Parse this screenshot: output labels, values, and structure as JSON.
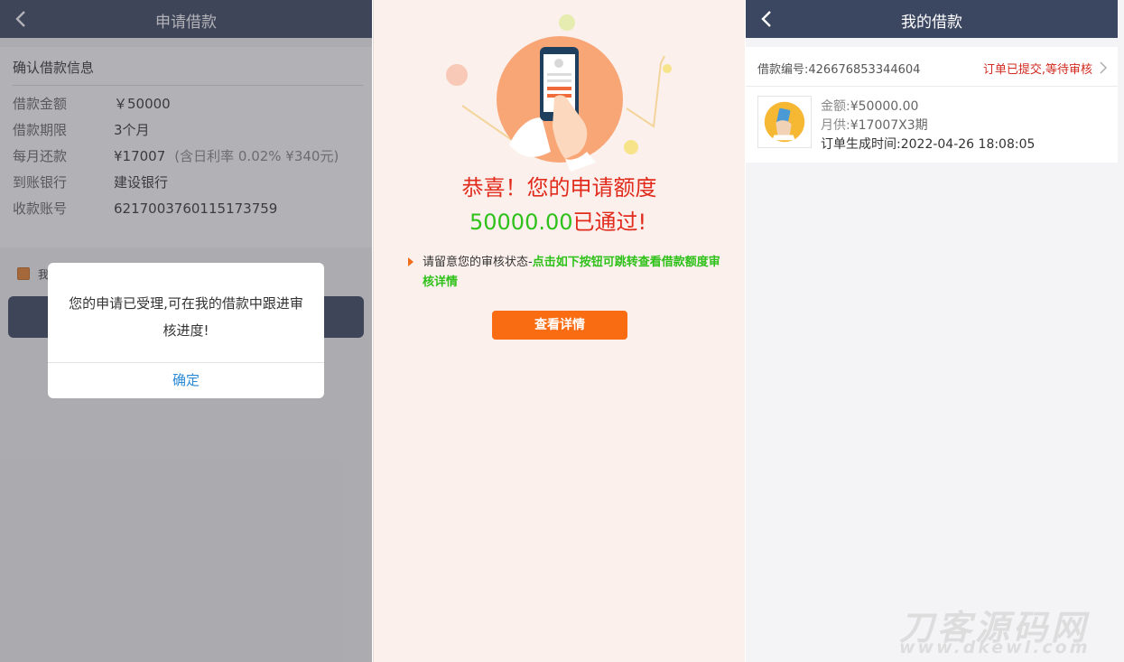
{
  "apply": {
    "title": "申请借款",
    "card_title": "确认借款信息",
    "rows": [
      {
        "label": "借款金额",
        "value": "￥50000"
      },
      {
        "label": "借款期限",
        "value": "3个月"
      },
      {
        "label": "每月还款",
        "value": "¥17007",
        "note": "(含日利率 0.02% ¥340元)"
      },
      {
        "label": "到账银行",
        "value": "建设银行"
      },
      {
        "label": "收款账号",
        "value": "6217003760115173759"
      }
    ],
    "agree_partial": "我",
    "dialog": {
      "message": "您的申请已受理,可在我的借款中跟进审核进度!",
      "confirm": "确定"
    }
  },
  "result": {
    "line1": "恭喜！您的申请额度",
    "amount": "50000.00",
    "passed": "已通过!",
    "tip_prefix": "请留意您的审核状态-",
    "tip_highlight": "点击如下按钮可跳转查看借款额度审核详情",
    "button": "查看详情"
  },
  "loans": {
    "title": "我的借款",
    "order_id_label": "借款编号:",
    "order_id": "426676853344604",
    "status": "订单已提交,等待审核",
    "amount_label": "金额:",
    "amount": "¥50000.00",
    "monthly_label": "月供:",
    "monthly": "¥17007X3期",
    "created_label": "订单生成时间:",
    "created": "2022-04-26 18:08:05"
  },
  "colors": {
    "nav": "#3b4660",
    "accent_orange": "#f96c12",
    "red": "#e12b1c",
    "green": "#2ec119",
    "link_blue": "#2a8ad6"
  },
  "icons": [
    "chevron-left-icon",
    "chevron-right-icon",
    "phone-hand-illustration",
    "card-hand-icon"
  ]
}
